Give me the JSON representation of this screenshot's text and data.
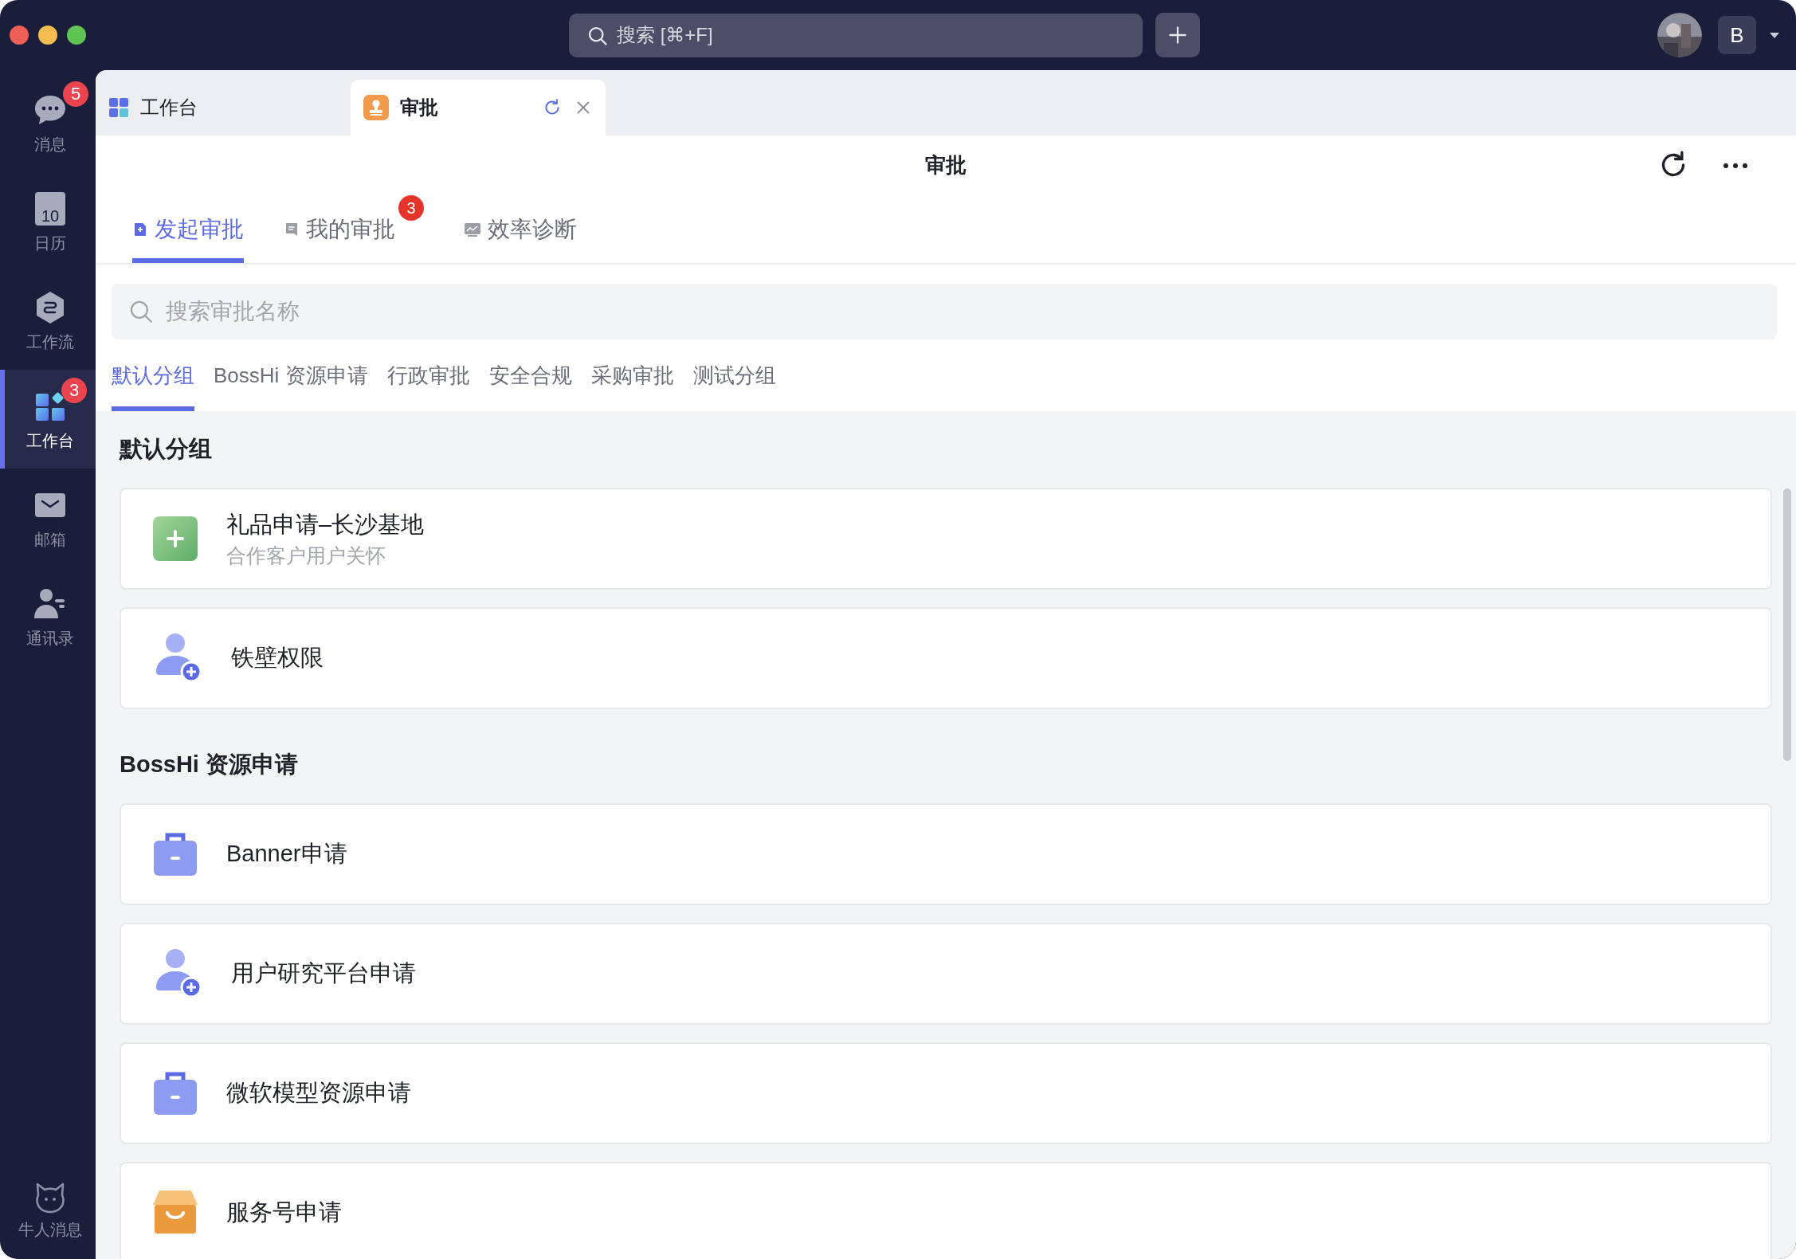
{
  "topbar": {
    "search_placeholder": "搜索 [⌘+F]",
    "avatar_letter": "B"
  },
  "sidebar": {
    "items": [
      {
        "label": "消息",
        "badge": "5",
        "selected": false
      },
      {
        "label": "日历",
        "icon_text": "10",
        "selected": false
      },
      {
        "label": "工作流",
        "selected": false
      },
      {
        "label": "工作台",
        "badge": "3",
        "selected": true
      },
      {
        "label": "邮箱",
        "selected": false
      },
      {
        "label": "通讯录",
        "selected": false
      }
    ],
    "bottom_item": {
      "label": "牛人消息"
    }
  },
  "tabs": [
    {
      "label": "工作台",
      "selected": false,
      "closable": false
    },
    {
      "label": "审批",
      "selected": true,
      "closable": true
    }
  ],
  "page": {
    "title": "审批",
    "subtabs": [
      {
        "label": "发起审批",
        "selected": true
      },
      {
        "label": "我的审批",
        "badge": "3",
        "selected": false
      },
      {
        "label": "效率诊断",
        "selected": false
      }
    ],
    "search_placeholder": "搜索审批名称",
    "categories": [
      {
        "label": "默认分组",
        "selected": true
      },
      {
        "label": "BossHi 资源申请",
        "selected": false
      },
      {
        "label": "行政审批",
        "selected": false
      },
      {
        "label": "安全合规",
        "selected": false
      },
      {
        "label": "采购审批",
        "selected": false
      },
      {
        "label": "测试分组",
        "selected": false
      }
    ],
    "sections": [
      {
        "title": "默认分组",
        "items": [
          {
            "kind": "gift",
            "name": "礼品申请–长沙基地",
            "description": "合作客户用户关怀"
          },
          {
            "kind": "user-add",
            "name": "铁壁权限"
          }
        ]
      },
      {
        "title": "BossHi 资源申请",
        "items": [
          {
            "kind": "briefcase",
            "name": "Banner申请"
          },
          {
            "kind": "user-add",
            "name": "用户研究平台申请"
          },
          {
            "kind": "briefcase",
            "name": "微软模型资源申请"
          },
          {
            "kind": "store",
            "name": "服务号申请"
          }
        ]
      }
    ]
  }
}
